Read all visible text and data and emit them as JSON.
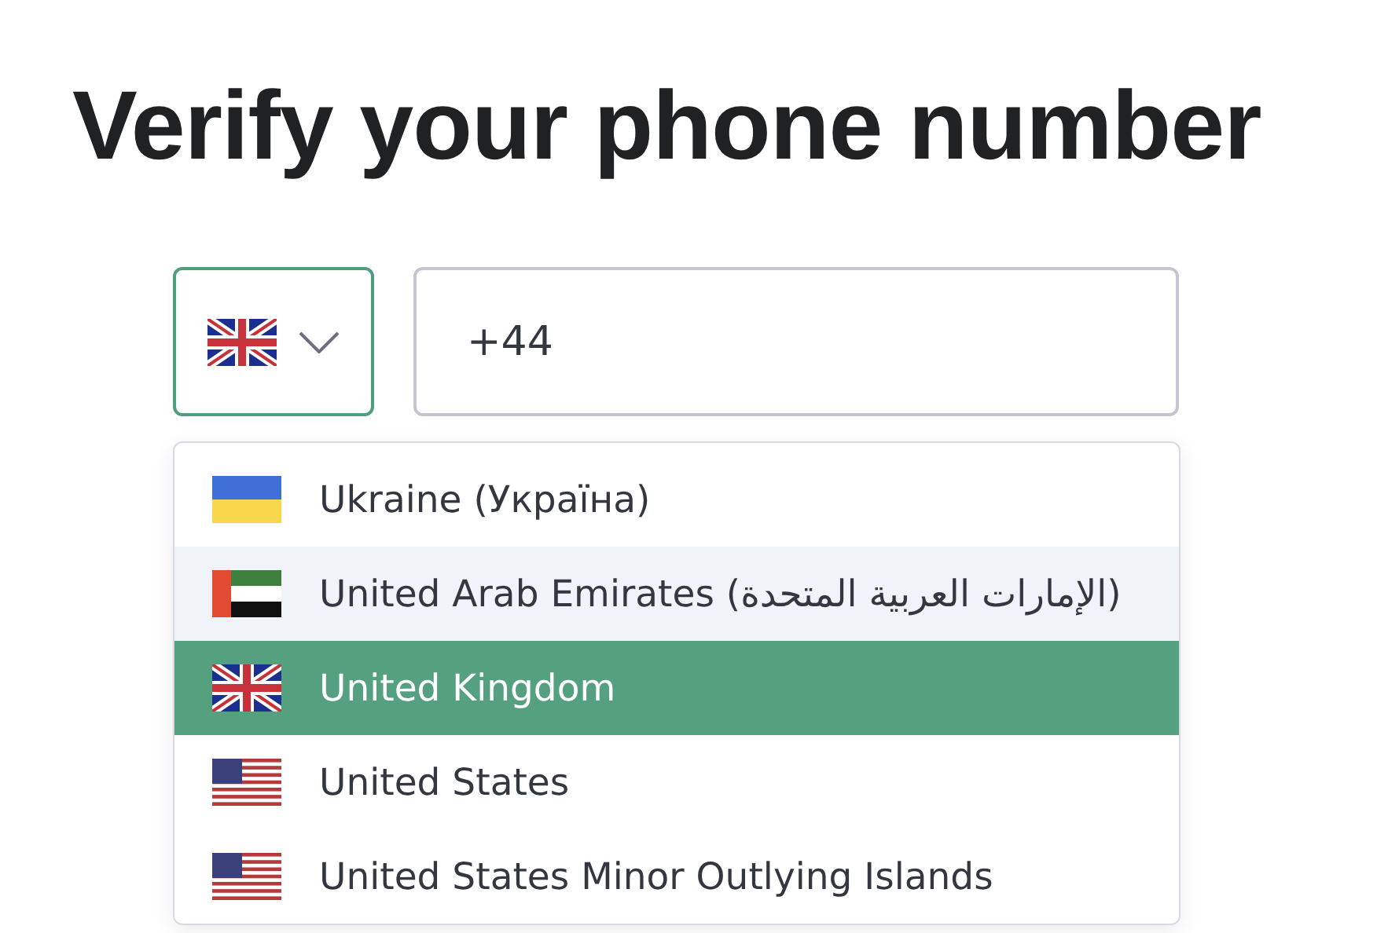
{
  "title": "Verify your phone number",
  "country_select": {
    "kind": "uk",
    "expanded": true
  },
  "phone_field": {
    "value": "+44"
  },
  "countries": [
    {
      "kind": "ua",
      "name": "Ukraine (Україна)",
      "hovered": false,
      "selected": false
    },
    {
      "kind": "ae",
      "name": "United Arab Emirates (الإمارات العربية المتحدة)",
      "hovered": true,
      "selected": false
    },
    {
      "kind": "uk",
      "name": "United Kingdom",
      "hovered": false,
      "selected": true
    },
    {
      "kind": "us",
      "name": "United States",
      "hovered": false,
      "selected": false
    },
    {
      "kind": "us",
      "name": "United States Minor Outlying Islands",
      "hovered": false,
      "selected": false
    }
  ]
}
